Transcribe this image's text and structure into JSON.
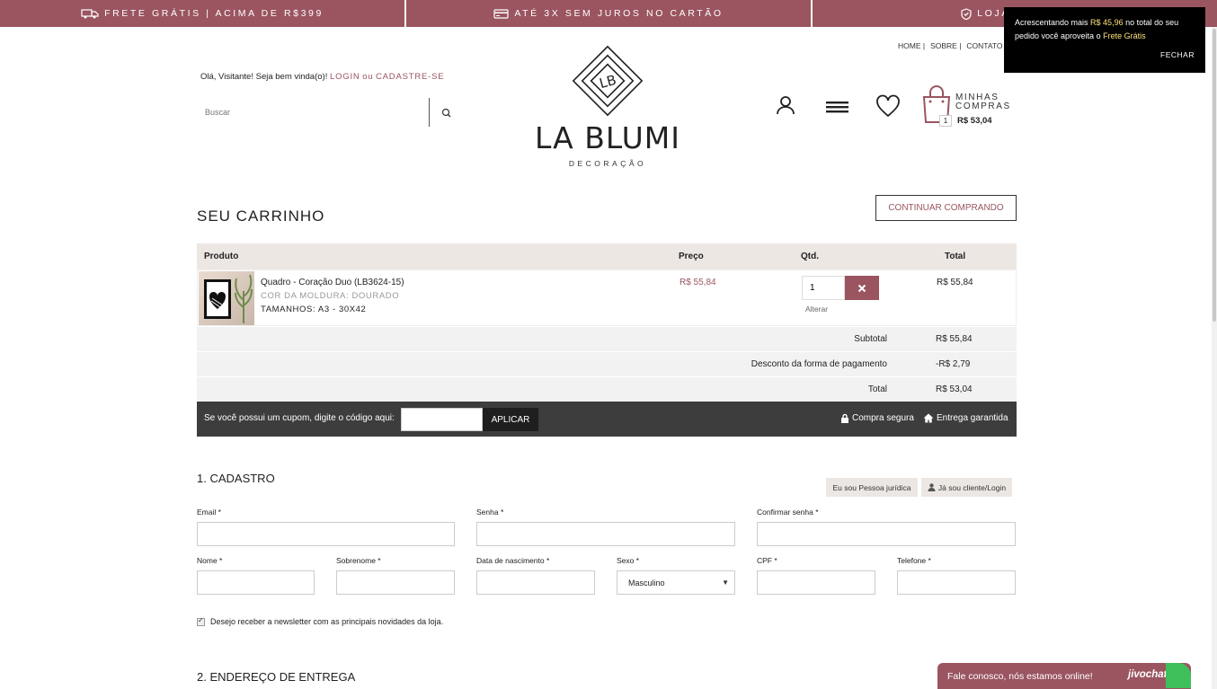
{
  "promo": [
    {
      "icon": "truck-icon",
      "label": "FRETE GRÁTIS | ACIMA DE R$399"
    },
    {
      "icon": "card-icon",
      "label": "ATÉ 3X SEM JUROS NO CARTÃO"
    },
    {
      "icon": "shield-icon",
      "label": "LOJA SEGURA"
    }
  ],
  "top_links": [
    "HOME |",
    "SOBRE |",
    "CONTATO"
  ],
  "greeting": {
    "text": "Olá, Visitante! Seja bem vinda(o)!",
    "login": "LOGIN",
    "or": "ou",
    "signup": "CADASTRE-SE"
  },
  "search": {
    "placeholder": "Buscar"
  },
  "logo": {
    "monogram": "LB",
    "name": "LA BLUMI",
    "tagline": "DECORAÇÃO"
  },
  "mini_cart": {
    "title_line1": "MINHAS",
    "title_line2": "COMPRAS",
    "count": "1",
    "total": "R$ 53,04"
  },
  "toast": {
    "text_before": "Acrescentando mais ",
    "amount": "R$ 45,96",
    "text_middle": " no total do seu pedido você aproveita o ",
    "highlight": "Frete Grátis",
    "close": "FECHAR"
  },
  "cart": {
    "heading": "SEU CARRINHO",
    "continue": "CONTINUAR COMPRANDO",
    "columns": {
      "product": "Produto",
      "price": "Preço",
      "qty": "Qtd.",
      "total": "Total"
    },
    "item": {
      "name": "Quadro - Coração Duo (LB3624-15)",
      "attr1": "COR DA MOLDURA: DOURADO",
      "attr2": "TAMANHOS: A3 - 30X42",
      "price": "R$ 55,84",
      "qty": "1",
      "change": "Alterar",
      "total": "R$ 55,84"
    },
    "subtotal": {
      "label": "Subtotal",
      "value": "R$ 55,84"
    },
    "discount": {
      "label": "Desconto da forma de pagamento",
      "value": "-R$ 2,79"
    },
    "total": {
      "label": "Total",
      "value": "R$ 53,04"
    },
    "coupon": {
      "label": "Se você possui um cupom, digite o código aqui:",
      "apply": "APLICAR",
      "secure": "Compra segura",
      "delivery": "Entrega garantida"
    }
  },
  "register": {
    "title": "1. CADASTRO",
    "pj_button": "Eu sou Pessoa jurídica",
    "login_button": "Já sou cliente/Login",
    "fields": {
      "email": "Email *",
      "password": "Senha *",
      "confirm": "Confirmar senha *",
      "first_name": "Nome *",
      "last_name": "Sobrenome *",
      "birth": "Data de nascimento *",
      "sex": "Sexo *",
      "sex_value": "Masculino",
      "cpf": "CPF *",
      "phone": "Telefone *"
    },
    "newsletter": "Desejo receber a newsletter com as principais novidades da loja."
  },
  "address": {
    "title": "2. ENDEREÇO DE ENTREGA"
  },
  "chat": {
    "text": "Fale conosco, nós estamos online!",
    "brand": "jivochat"
  },
  "colors": {
    "brand": "#9a5560",
    "dark": "#3d3d3d",
    "light_bg": "#ede7e4"
  }
}
